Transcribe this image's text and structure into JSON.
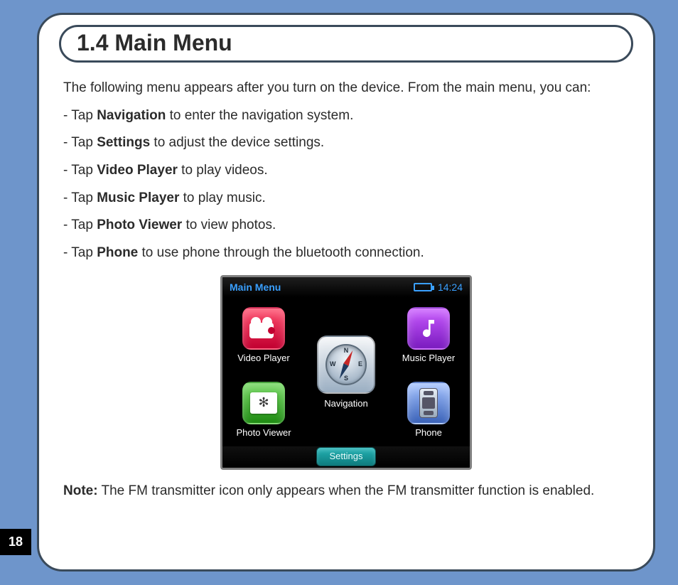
{
  "page_number": "18",
  "heading": "1.4 Main Menu",
  "intro": "The following menu appears after you turn on the device. From the main menu, you can:",
  "bullets": [
    {
      "prefix": "- Tap ",
      "bold": "Navigation",
      "suffix": " to enter the navigation system."
    },
    {
      "prefix": "- Tap ",
      "bold": "Settings",
      "suffix": " to adjust the device settings."
    },
    {
      "prefix": "- Tap ",
      "bold": "Video Player",
      "suffix": " to play videos."
    },
    {
      "prefix": "- Tap ",
      "bold": "Music Player",
      "suffix": " to play music."
    },
    {
      "prefix": "- Tap ",
      "bold": "Photo Viewer",
      "suffix": " to view photos."
    },
    {
      "prefix": "- Tap ",
      "bold": "Phone",
      "suffix": " to use phone through the bluetooth connection."
    }
  ],
  "note_label": "Note:",
  "note_text": " The FM transmitter icon only appears when the FM transmitter function is enabled.",
  "device": {
    "status_title": "Main Menu",
    "clock": "14:24",
    "tiles": {
      "video": "Video Player",
      "music": "Music Player",
      "photo": "Photo Viewer",
      "phone": "Phone",
      "nav": "Navigation"
    },
    "compass": {
      "n": "N",
      "s": "S",
      "e": "E",
      "w": "W"
    },
    "settings_label": "Settings"
  }
}
